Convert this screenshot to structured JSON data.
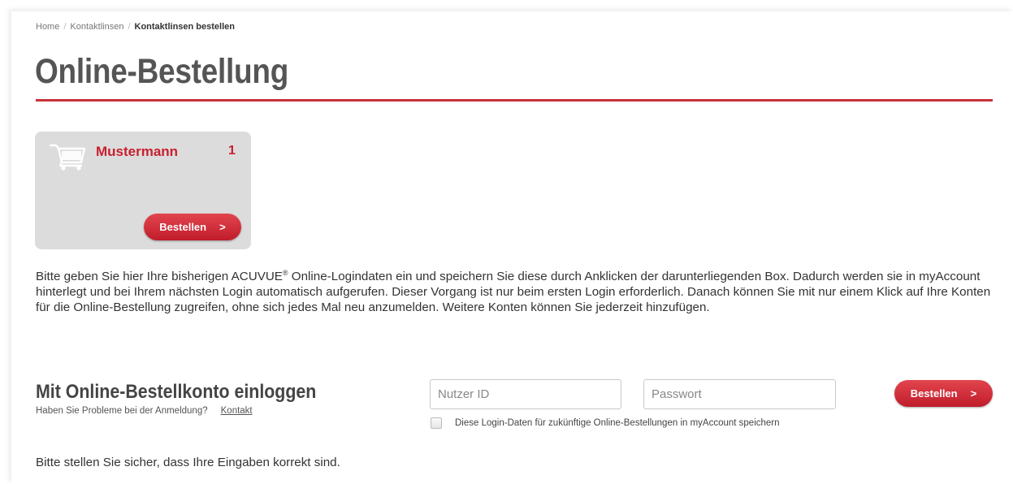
{
  "breadcrumb": {
    "items": [
      "Home",
      "Kontaktlinsen"
    ],
    "current": "Kontaktlinsen bestellen",
    "separator": "/"
  },
  "page": {
    "title": "Online-Bestellung"
  },
  "account_card": {
    "icon": "cart-icon",
    "name": "Mustermann",
    "count": "1",
    "button_label": "Bestellen",
    "button_chevron": ">"
  },
  "info": {
    "text_before_sup": "Bitte geben Sie hier Ihre bisherigen ACUVUE",
    "sup": "®",
    "text_after_sup": " Online-Logindaten ein und speichern Sie diese durch Anklicken der darunterliegenden Box. Dadurch werden sie in myAccount hinterlegt und bei Ihrem nächsten Login automatisch aufgerufen. Dieser Vorgang ist nur beim ersten Login erforderlich. Danach können Sie mit nur einem Klick auf Ihre Konten für die Online-Bestellung zugreifen, ohne sich jedes Mal neu anzumelden. Weitere Konten können Sie jederzeit hinzufügen."
  },
  "login": {
    "heading": "Mit Online-Bestellkonto einloggen",
    "help_text": "Haben Sie Probleme bei der Anmeldung?",
    "help_link": "Kontakt",
    "user_placeholder": "Nutzer ID",
    "password_placeholder": "Passwort",
    "button_label": "Bestellen",
    "button_chevron": ">",
    "remember_label": "Diese Login-Daten für zukünftige Online-Bestellungen in myAccount speichern"
  },
  "notice": "Bitte stellen Sie sicher, dass Ihre Eingaben korrekt sind.",
  "colors": {
    "accent": "#c8323a",
    "card_name": "#c8202f",
    "card_background": "#dcdcdc"
  }
}
